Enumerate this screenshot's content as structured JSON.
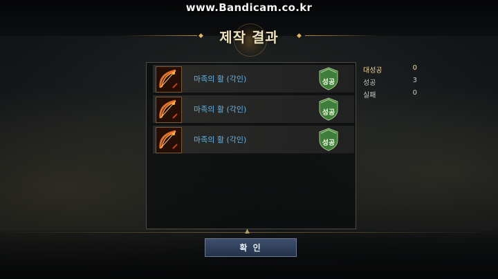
{
  "watermark": "www.Bandicam.co.kr",
  "dialog": {
    "title": "제작 결과",
    "confirm_label": "확 인"
  },
  "results": [
    {
      "item_name": "마족의 활 (각인)",
      "result_badge": "성공",
      "icon": "bow-icon"
    },
    {
      "item_name": "마족의 활 (각인)",
      "result_badge": "성공",
      "icon": "bow-icon"
    },
    {
      "item_name": "마족의 활 (각인)",
      "result_badge": "성공",
      "icon": "bow-icon"
    }
  ],
  "stats": [
    {
      "label": "대성공",
      "value": "0"
    },
    {
      "label": "성공",
      "value": "3"
    },
    {
      "label": "실패",
      "value": "0"
    }
  ],
  "colors": {
    "item_name": "#5fb4ea",
    "title": "#f1e2bf",
    "highlight_stat": "#f2d79a",
    "success_badge": "#3f7d3a",
    "confirm_button": "#2f3f5a"
  }
}
